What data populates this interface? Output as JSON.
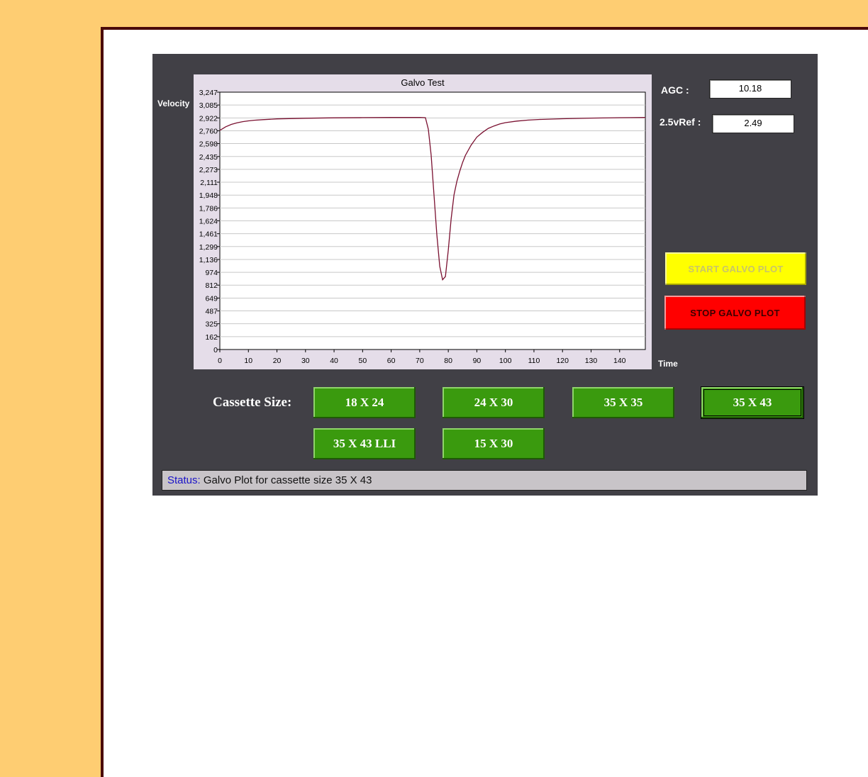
{
  "panel": {
    "agc_label": "AGC :",
    "agc_value": "10.18",
    "vref_label": "2.5vRef :",
    "vref_value": "2.49",
    "start_button": "START GALVO PLOT",
    "stop_button": "STOP GALVO PLOT",
    "cassette_label": "Cassette Size:",
    "cassette_sizes": [
      "18 X 24",
      "24 X 30",
      "35 X 35",
      "35 X 43",
      "35 X 43 LLI",
      "15 X 30"
    ],
    "selected_cassette": "35 X 43",
    "status_key": "Status:",
    "status_text": " Galvo Plot for cassette size 35 X 43"
  },
  "colors": {
    "panel_bg": "#414046",
    "chart_bg": "#e5dde9",
    "line": "#7a1030",
    "cassette_green": "#3a9a0e",
    "start_yellow": "#ffff00",
    "stop_red": "#ff0000"
  },
  "chart_data": {
    "type": "line",
    "title": "Galvo Test",
    "xlabel": "Time",
    "ylabel": "Velocity",
    "xlim": [
      0,
      149
    ],
    "ylim": [
      0,
      3247
    ],
    "x_ticks": [
      0,
      10,
      20,
      30,
      40,
      50,
      60,
      70,
      80,
      90,
      100,
      110,
      120,
      130,
      140
    ],
    "y_ticks": [
      "0",
      "162",
      "325",
      "487",
      "649",
      "812",
      "974",
      "1,136",
      "1,299",
      "1,461",
      "1,624",
      "1,786",
      "1,948",
      "2,111",
      "2,273",
      "2,435",
      "2,598",
      "2,760",
      "2,922",
      "3,085",
      "3,247"
    ],
    "y_tick_values": [
      0,
      162,
      325,
      487,
      649,
      812,
      974,
      1136,
      1299,
      1461,
      1624,
      1786,
      1948,
      2111,
      2273,
      2435,
      2598,
      2760,
      2922,
      3085,
      3247
    ],
    "grid": true,
    "series": [
      {
        "x": [
          0,
          2,
          4,
          6,
          8,
          10,
          12,
          15,
          20,
          30,
          40,
          50,
          60,
          70,
          72,
          73,
          74,
          75,
          76,
          77,
          78,
          79,
          80,
          81,
          82,
          83,
          84,
          85,
          86,
          88,
          90,
          92,
          94,
          96,
          98,
          100,
          104,
          108,
          112,
          120,
          130,
          140,
          149
        ],
        "y": [
          2765,
          2810,
          2840,
          2860,
          2875,
          2885,
          2893,
          2900,
          2910,
          2918,
          2923,
          2926,
          2928,
          2929,
          2925,
          2780,
          2450,
          1950,
          1450,
          1050,
          880,
          920,
          1250,
          1650,
          1950,
          2120,
          2250,
          2360,
          2450,
          2580,
          2680,
          2740,
          2790,
          2820,
          2845,
          2862,
          2882,
          2895,
          2903,
          2912,
          2920,
          2925,
          2928
        ]
      }
    ]
  }
}
